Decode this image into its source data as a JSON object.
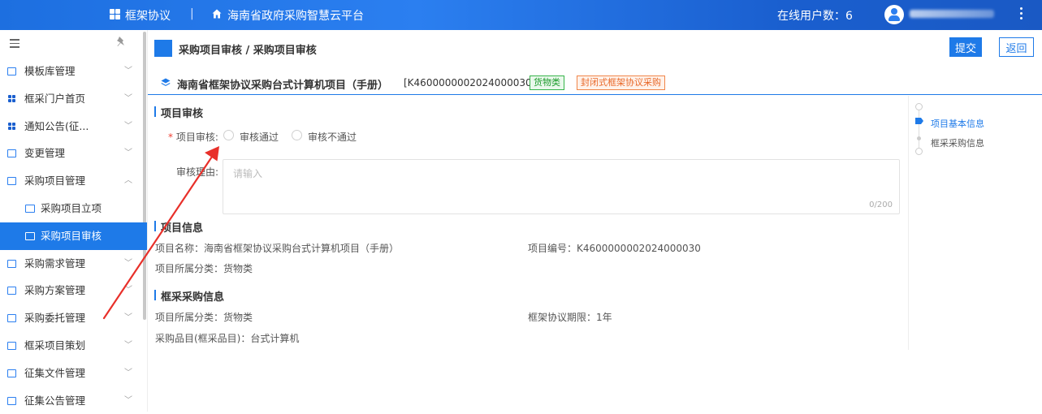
{
  "topbar": {
    "app_title": "框架协议",
    "separator": "|",
    "platform_name": "海南省政府采购智慧云平台",
    "online_users": "在线用户数：6",
    "icons": [
      "grid-icon",
      "home-icon",
      "avatar-icon",
      "more-vertical-icon"
    ]
  },
  "sidebar": {
    "items": [
      {
        "label": "模板库管理",
        "icon": "template-icon",
        "chevron": "﹀"
      },
      {
        "label": "框采门户首页",
        "icon": "grid-icon",
        "chevron": "﹀"
      },
      {
        "label": "通知公告(征...",
        "icon": "grid-icon",
        "chevron": "﹀"
      },
      {
        "label": "变更管理",
        "icon": "change-icon",
        "chevron": "﹀"
      },
      {
        "label": "采购项目管理",
        "icon": "folder-icon",
        "chevron": "︿"
      }
    ],
    "subitems": [
      {
        "label": "采购项目立项"
      },
      {
        "label": "采购项目审核"
      }
    ],
    "items_after": [
      {
        "label": "采购需求管理",
        "chevron": "﹀"
      },
      {
        "label": "采购方案管理",
        "chevron": "﹀"
      },
      {
        "label": "采购委托管理",
        "chevron": "﹀"
      },
      {
        "label": "框采项目策划",
        "chevron": "﹀"
      },
      {
        "label": "征集文件管理",
        "chevron": "﹀"
      },
      {
        "label": "征集公告管理",
        "chevron": "﹀"
      }
    ],
    "pin_glyph": "📌"
  },
  "breadcrumb": {
    "text": "采购项目审核 / 采购项目审核",
    "submit_label": "提交",
    "back_label": "返回"
  },
  "project": {
    "name": "海南省框架协议采购台式计算机项目（手册）",
    "code": "[K4600000002024000030]",
    "tag_category": "货物类",
    "tag_type": "封闭式框架协议采购"
  },
  "review": {
    "section_title": "项目审核",
    "required_mark": "*",
    "review_label": "项目审核:",
    "option_pass": "审核通过",
    "option_fail": "审核不通过",
    "reason_label": "审核理由:",
    "reason_placeholder": "请输入",
    "reason_count": "0/200"
  },
  "project_info": {
    "section_title": "项目信息",
    "name_label": "项目名称：海南省框架协议采购台式计算机项目（手册）",
    "code_label": "项目编号：K4600000002024000030",
    "category_label": "项目所属分类：货物类"
  },
  "framework_info": {
    "section_title": "框采采购信息",
    "category_label": "项目所属分类：货物类",
    "period_label": "框架协议期限：1年",
    "catalog_label": "采购品目(框采品目)：台式计算机"
  },
  "anchor_nav": {
    "items": [
      {
        "label": "项目基本信息",
        "active": true
      },
      {
        "label": "框采采购信息",
        "active": false
      }
    ]
  },
  "colors": {
    "primary": "#1e7ae8",
    "annotation_arrow": "#e8302a"
  }
}
